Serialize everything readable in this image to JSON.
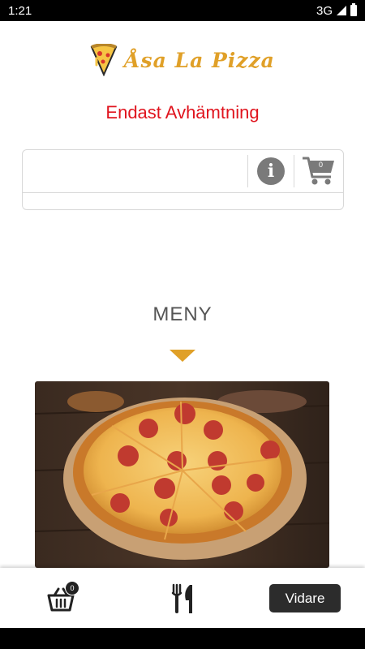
{
  "status_bar": {
    "time": "1:21",
    "network": "3G"
  },
  "brand": {
    "name": "Åsa La Pizza",
    "accent": "#e0a028"
  },
  "subtitle": "Endast Avhämtning",
  "toolbar": {
    "search_value": "",
    "info_icon": "info-icon",
    "cart_icon": "cart-icon",
    "cart_count": "0"
  },
  "menu": {
    "title": "MENY"
  },
  "bottom_bar": {
    "basket_count": "0",
    "next_label": "Vidare"
  },
  "colors": {
    "subtitle": "#e0141e",
    "button": "#2c2c2c"
  }
}
